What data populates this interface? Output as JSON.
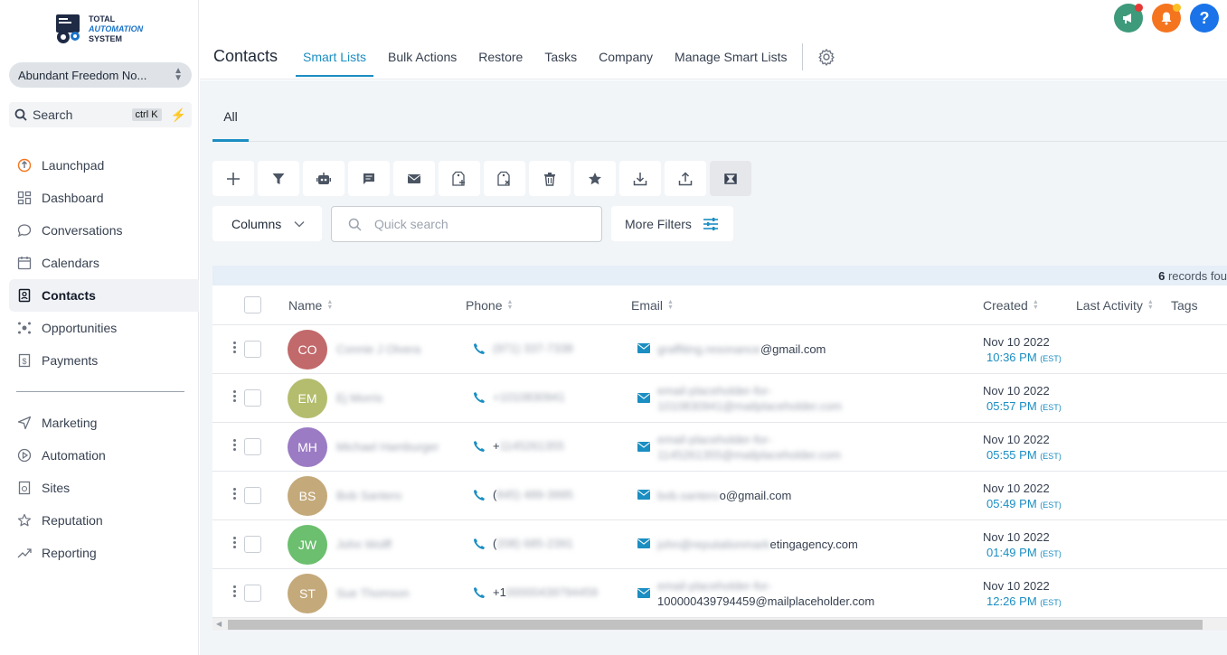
{
  "brand": {
    "line1": "TOTAL",
    "line2": "AUTOMATION",
    "line3": "SYSTEM"
  },
  "location": {
    "name": "Abundant Freedom No..."
  },
  "sidebar_search": {
    "label": "Search",
    "shortcut": "ctrl K"
  },
  "nav": [
    {
      "label": "Launchpad",
      "icon": "launchpad-icon"
    },
    {
      "label": "Dashboard",
      "icon": "dashboard-icon"
    },
    {
      "label": "Conversations",
      "icon": "chat-icon"
    },
    {
      "label": "Calendars",
      "icon": "calendar-icon"
    },
    {
      "label": "Contacts",
      "icon": "contacts-icon",
      "active": true
    },
    {
      "label": "Opportunities",
      "icon": "opportunities-icon"
    },
    {
      "label": "Payments",
      "icon": "payments-icon"
    },
    {
      "label": "Marketing",
      "icon": "send-icon"
    },
    {
      "label": "Automation",
      "icon": "automation-icon"
    },
    {
      "label": "Sites",
      "icon": "sites-icon"
    },
    {
      "label": "Reputation",
      "icon": "star-icon"
    },
    {
      "label": "Reporting",
      "icon": "trend-icon"
    }
  ],
  "header": {
    "title": "Contacts",
    "tabs": [
      "Smart Lists",
      "Bulk Actions",
      "Restore",
      "Tasks",
      "Company",
      "Manage Smart Lists"
    ],
    "active_tab": "Smart Lists",
    "help_label": "?"
  },
  "subtabs": {
    "all": "All"
  },
  "toolbar": {
    "tools": [
      "add-icon",
      "filter-icon",
      "robot-icon",
      "message-icon",
      "email-icon",
      "add-tag-icon",
      "remove-tag-icon",
      "delete-icon",
      "star-icon",
      "import-icon",
      "export-icon",
      "merge-icon"
    ]
  },
  "filters": {
    "columns_label": "Columns",
    "search_placeholder": "Quick search",
    "more_filters_label": "More Filters"
  },
  "records": {
    "count": "6",
    "suffix": " records fou"
  },
  "table": {
    "headers": {
      "name": "Name",
      "phone": "Phone",
      "email": "Email",
      "created": "Created",
      "last_activity": "Last Activity",
      "tags": "Tags"
    },
    "rows": [
      {
        "initials": "CO",
        "color": "#c2696b",
        "name": "Connie J Olvera",
        "phone_visible": "",
        "phone_blur": "(971) 337-7338",
        "email_blur": "graffiting.resonance",
        "email_visible": "@gmail.com",
        "email_blur2": "",
        "email_visible2": "",
        "date": "Nov 10 2022",
        "time": "10:36 PM",
        "tz": "(EST)"
      },
      {
        "initials": "EM",
        "color": "#b4bd6e",
        "name": "Ej Morris",
        "phone_visible": "",
        "phone_blur": "+1010830941",
        "email_blur": "email-placeholder-for-",
        "email_visible": "",
        "email_blur2": "1010830941@mailplaceholder.com",
        "email_visible2": "",
        "date": "Nov 10 2022",
        "time": "05:57 PM",
        "tz": "(EST)"
      },
      {
        "initials": "MH",
        "color": "#9b7bc4",
        "name": "Michael Hamburger",
        "phone_visible": "+",
        "phone_blur": "1145261355",
        "email_blur": "email-placeholder-for-",
        "email_visible": "",
        "email_blur2": "1145261355@mailplaceholder.com",
        "email_visible2": "",
        "date": "Nov 10 2022",
        "time": "05:55 PM",
        "tz": "(EST)"
      },
      {
        "initials": "BS",
        "color": "#c4a97a",
        "name": "Bob Santero",
        "phone_visible": "(",
        "phone_blur": "845) 489-3995",
        "email_blur": "bob.santero",
        "email_visible": "o@gmail.com",
        "email_blur2": "",
        "email_visible2": "",
        "date": "Nov 10 2022",
        "time": "05:49 PM",
        "tz": "(EST)"
      },
      {
        "initials": "JW",
        "color": "#6bbf6e",
        "name": "John Wolff",
        "phone_visible": "(",
        "phone_blur": "208) 685-2391",
        "email_blur": "john@reputationmark",
        "email_visible": "etingagency.com",
        "email_blur2": "",
        "email_visible2": "",
        "date": "Nov 10 2022",
        "time": "01:49 PM",
        "tz": "(EST)"
      },
      {
        "initials": "ST",
        "color": "#c4a97a",
        "name": "Sue Thomson",
        "phone_visible": "+1",
        "phone_blur": "00000439794459",
        "email_blur": "email-placeholder-for-",
        "email_visible": "",
        "email_blur2": "",
        "email_visible2": "100000439794459@mailplaceholder.com",
        "date": "Nov 10 2022",
        "time": "12:26 PM",
        "tz": "(EST)"
      }
    ]
  },
  "colors": {
    "accent": "#1b8ec2",
    "announce": "#3d9a7a",
    "bell": "#f5741e",
    "help": "#1a73e8"
  }
}
